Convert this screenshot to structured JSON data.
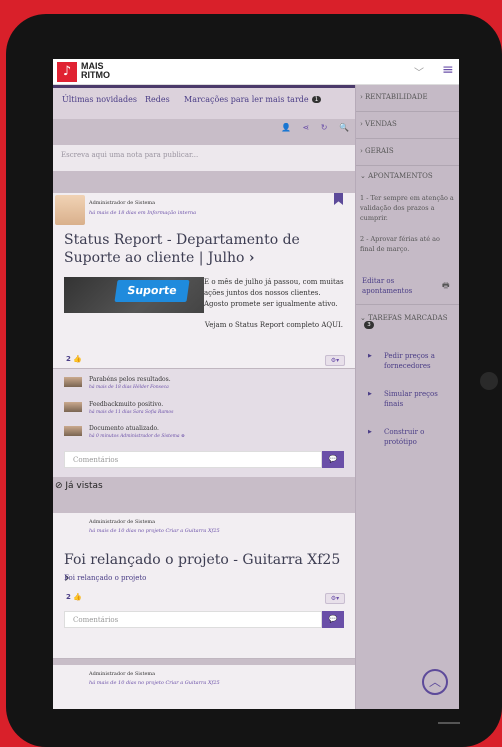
{
  "app": {
    "brand_line1": "MAIS",
    "brand_line2": "RITMO",
    "logo_glyph": "♪",
    "chevron": "﹀",
    "menu_icon": "≡"
  },
  "tabs": [
    {
      "label": "Últimas novidades"
    },
    {
      "label": "Redes"
    },
    {
      "label": "Marcações para ler mais tarde",
      "badge": "1"
    }
  ],
  "toolbar_icons": "👤 ⋖ ↻ 🔍",
  "compose": {
    "placeholder": "Escreva aqui uma nota para publicar..."
  },
  "post1": {
    "author": "Administrador de Sistema",
    "meta": "há mais de 18 dias em Informação interna",
    "title": "Status Report - Departamento de Suporte ao cliente | Julho",
    "image_label": "Suporte",
    "text": "E o mês de julho já passou, com muitas ações juntos dos nossos clientes. Agosto promete ser igualmente ativo.",
    "read_more": "Vejam o Status Report completo AQUI.",
    "likes": "2 👍",
    "comments": [
      {
        "text": "Parabéns pelos resultados.",
        "meta": "há mais de 18 dias  Hélder Fonseca"
      },
      {
        "text": "Feedbackmuito positivo.",
        "meta": "há mais de 11 dias  Sara Sofia Ramos"
      },
      {
        "text": "Documento atualizado.",
        "meta": "há 0 minutos  Administrador de Sistema  ⊗"
      }
    ],
    "comment_placeholder": "Comentários"
  },
  "seen_label": "⊘ Já vistas",
  "post2": {
    "author": "Administrador de Sistema",
    "meta": "há mais de 10 dias no projeto Criar a Guitarra Xf25",
    "title": "Foi relançado o projeto - Guitarra Xf25",
    "subtitle": "Foi relançado o projeto",
    "likes": "2 👍",
    "comment_placeholder": "Comentários"
  },
  "post3": {
    "author": "Administrador de Sistema",
    "meta": "há mais de 10 dias no projeto Criar a Guitarra Xf25"
  },
  "sidebar": {
    "rentabilidade": "› RENTABILIDADE",
    "vendas": "› VENDAS",
    "gerais": "› GERAIS",
    "apontamentos": "⌄ APONTAMENTOS",
    "note1": "1 - Ter sempre em atenção a validação dos prazos a cumprir.",
    "note2": "2 - Aprovar férias até ao final de março.",
    "editar": "Editar os apontamentos",
    "tarefas": "⌄ TAREFAS MARCADAS",
    "tarefas_count": "3",
    "tasks": [
      {
        "label": "Pedir preços a fornecedores"
      },
      {
        "label": "Simular preços finais"
      },
      {
        "label": "Construir o protótipo"
      }
    ]
  }
}
